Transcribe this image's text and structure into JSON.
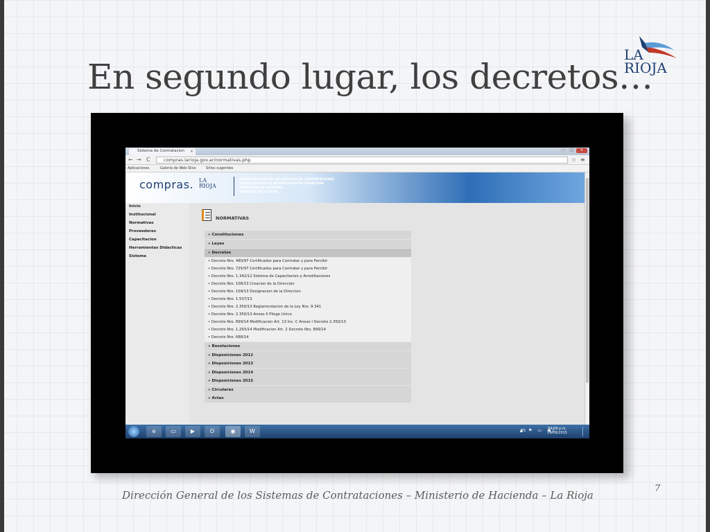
{
  "slide": {
    "title": "En segundo lugar, los decretos…",
    "logo_line1": "LA",
    "logo_line2": "RIOJA",
    "footer": "Dirección General de los Sistemas de Contrataciones – Ministerio de Hacienda – La Rioja",
    "page_number": "7"
  },
  "browser": {
    "tab_title": "Sistema de Contratacion",
    "tab_close": "×",
    "url": "compras.larioja.gov.ar/normativas.php",
    "bookmarks": [
      "Aplicaciones",
      "Galería de Web Slice",
      "Sitios sugeridos"
    ],
    "window_controls": {
      "minimize": "–",
      "maximize": "□",
      "close": "×"
    },
    "nav": {
      "back": "←",
      "forward": "→",
      "reload": "C",
      "star": "☆",
      "menu": "≡"
    }
  },
  "site": {
    "logo_text": "compras.",
    "logo_la": "LA",
    "logo_rioja": "RIOJA",
    "info_lines": [
      "DIRECCIÓN GENERAL DE SISTEMAS DE CONTRATACIONES",
      "SUBSECRETARÍA DE ADMINISTRACIÓN FINANCIERA",
      "MINISTERIO DE HACIENDA",
      "GOBIERNO DE LA RIOJA"
    ],
    "sidebar": [
      "Inicio",
      "Institucional",
      "Normativas",
      "Proveedores",
      "Capacitacion",
      "Herramientas Didacticas",
      "Sistema"
    ],
    "section_title": "NORMATIVAS",
    "menu_top": [
      "» Constituciones",
      "» Leyes",
      "» Decretos"
    ],
    "decretos": [
      "• Decreto Nro. 480/97 Certificados para Contratar y para Percibir",
      "• Decreto Nro. 725/97 Certificados para Contratar y para Percibir",
      "• Decreto Nro. 1.342/12 Sistema de Capacitacion y Acreditaciones",
      "• Decreto Nro. 108/13 Creacion de la Direccion",
      "• Decreto Nro. 109/13 Designacion de la Direccion",
      "• Decreto Nro. 1.537/13",
      "• Decreto Nro. 2.350/13 Reglamentacion de la Ley Nro. 9.341",
      "• Decreto Nro. 2.350/13 Anexo II Pliego Unico",
      "• Decreto Nro. 899/14 Modificacion Art. 13 Inc. C Anexo I Decreto 2.350/13",
      "• Decreto Nro. 1.293/14 Modificacion Art. 2 Decreto Nro. 899/14",
      "• Decreto Nro. 688/14"
    ],
    "menu_bottom": [
      "» Resoluciones",
      "» Disposiciones 2012",
      "» Disposiciones 2013",
      "» Disposiciones 2014",
      "» Disposiciones 2015",
      "» Circulares",
      "» Actas"
    ]
  },
  "taskbar": {
    "lang": "ES",
    "time": "04:58 p.m.",
    "date": "14/09/2015",
    "tray_icons": "▲ ⚑ ▭ ◀)"
  }
}
